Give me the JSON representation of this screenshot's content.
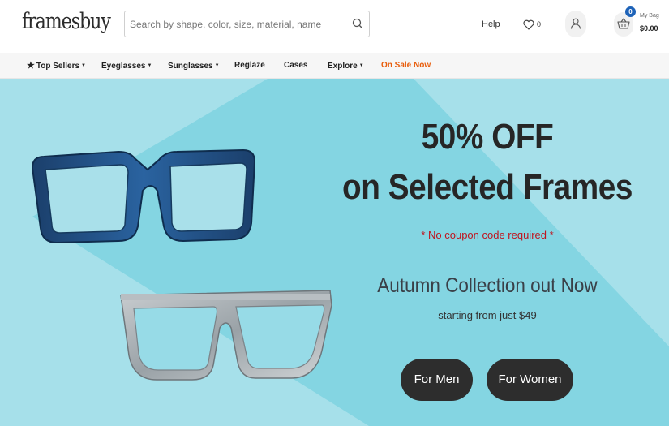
{
  "header": {
    "logo": "framesbuy",
    "search_placeholder": "Search by shape, color, size, material, name",
    "help_label": "Help",
    "wishlist_count": "0",
    "bag_count": "0",
    "bag_label": "My Bag",
    "bag_total": "$0.00"
  },
  "nav": {
    "items": [
      {
        "label": "Top Sellers",
        "dropdown": true,
        "icon": "star-icon"
      },
      {
        "label": "Eyeglasses",
        "dropdown": true
      },
      {
        "label": "Sunglasses",
        "dropdown": true
      },
      {
        "label": "Reglaze",
        "dropdown": false
      },
      {
        "label": "Cases",
        "dropdown": false
      },
      {
        "label": "Explore",
        "dropdown": true
      },
      {
        "label": "On Sale Now",
        "dropdown": false
      }
    ]
  },
  "hero": {
    "title_line1": "50% OFF",
    "title_line2": "on Selected Frames",
    "note": "* No coupon code required *",
    "subtitle": "Autumn Collection out Now",
    "price_text": "starting from just $49",
    "buttons": [
      "For Men",
      "For Women"
    ]
  },
  "colors": {
    "hero_background": "#a6e0ea",
    "hero_band": "#84d5e2",
    "button": "#2d2d2d",
    "sale": "#e85d0c",
    "note": "#c0141e",
    "badge": "#1e63b8"
  },
  "icons": {
    "search": "search-icon",
    "wishlist": "heart-icon",
    "account": "user-icon",
    "bag": "basket-icon"
  }
}
